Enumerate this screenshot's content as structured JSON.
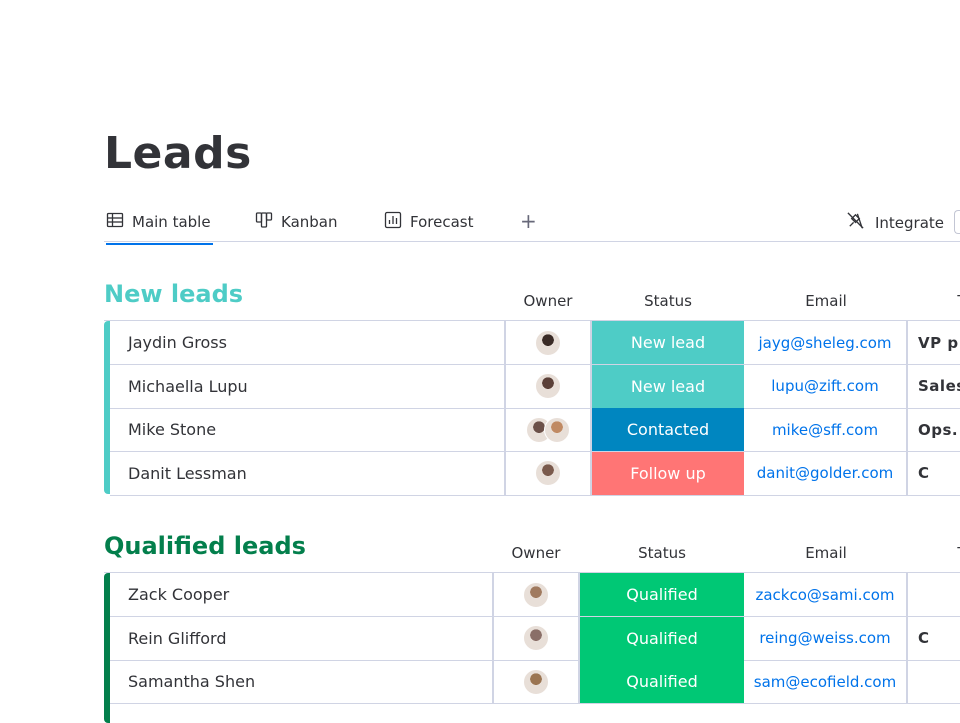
{
  "page": {
    "title": "Leads"
  },
  "tabs": [
    {
      "label": "Main table",
      "icon": "table-icon",
      "active": true
    },
    {
      "label": "Kanban",
      "icon": "kanban-icon",
      "active": false
    },
    {
      "label": "Forecast",
      "icon": "chart-icon",
      "active": false
    }
  ],
  "toolbar": {
    "add_label": "+",
    "integrate_label": "Integrate"
  },
  "colors": {
    "accent": "#0073ea",
    "new_leads": "#4eccc6",
    "qualified_leads": "#037f4c",
    "status_new_lead": "#4eccc6",
    "status_contacted": "#0086c0",
    "status_follow_up": "#ff7575",
    "status_qualified": "#00c875"
  },
  "groups": [
    {
      "title": "New leads",
      "color": "#4eccc6",
      "columns": {
        "owner": "Owner",
        "status": "Status",
        "email": "Email",
        "title": "T"
      },
      "rows": [
        {
          "name": "Jaydin Gross",
          "status": "New lead",
          "status_color": "#4eccc6",
          "email": "jayg@sheleg.com",
          "title": "VP p",
          "avatars": [
            "#3a2b26"
          ]
        },
        {
          "name": "Michaella Lupu",
          "status": "New lead",
          "status_color": "#4eccc6",
          "email": "lupu@zift.com",
          "title": "Sales",
          "avatars": [
            "#5b4038"
          ]
        },
        {
          "name": "Mike Stone",
          "status": "Contacted",
          "status_color": "#0086c0",
          "email": "mike@sff.com",
          "title": "Ops.",
          "avatars": [
            "#6b5048",
            "#c08a63"
          ]
        },
        {
          "name": "Danit Lessman",
          "status": "Follow up",
          "status_color": "#ff7575",
          "email": "danit@golder.com",
          "title": "C",
          "avatars": [
            "#7a5a4c"
          ]
        }
      ]
    },
    {
      "title": "Qualified leads",
      "color": "#037f4c",
      "columns": {
        "owner": "Owner",
        "status": "Status",
        "email": "Email",
        "title": "T"
      },
      "rows": [
        {
          "name": "Zack Cooper",
          "status": "Qualified",
          "status_color": "#00c875",
          "email": "zackco@sami.com",
          "title": "",
          "avatars": [
            "#a07a5f"
          ]
        },
        {
          "name": "Rein Glifford",
          "status": "Qualified",
          "status_color": "#00c875",
          "email": "reing@weiss.com",
          "title": "C",
          "avatars": [
            "#8a6f68"
          ]
        },
        {
          "name": "Samantha Shen",
          "status": "Qualified",
          "status_color": "#00c875",
          "email": "sam@ecofield.com",
          "title": "",
          "avatars": [
            "#9b7552"
          ]
        }
      ]
    }
  ]
}
